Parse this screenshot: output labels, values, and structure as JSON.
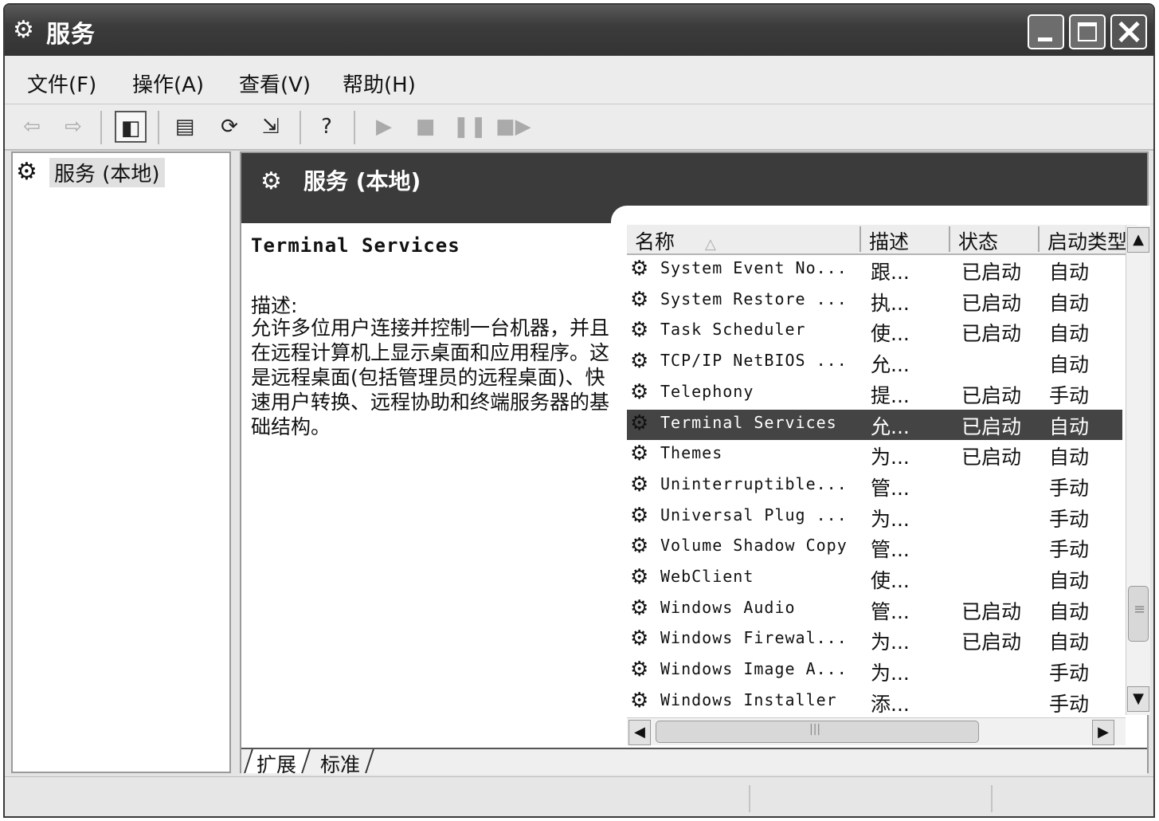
{
  "window": {
    "title": "服务",
    "icon": "services-gear-icon"
  },
  "menu": [
    "文件(F)",
    "操作(A)",
    "查看(V)",
    "帮助(H)"
  ],
  "toolbar": {
    "icons": [
      "back-arrow-icon",
      "forward-arrow-icon",
      "show-hide-tree-icon",
      "properties-icon",
      "refresh-icon",
      "export-list-icon",
      "help-icon",
      "start-service-icon",
      "stop-service-icon",
      "pause-service-icon",
      "restart-service-icon"
    ]
  },
  "tree": {
    "root_label": "服务 (本地)"
  },
  "pane": {
    "header_title": "服务 (本地)",
    "selected_service_name": "Terminal Services",
    "description_label": "描述:",
    "description_text": "允许多位用户连接并控制一台机器，并且在远程计算机上显示桌面和应用程序。这是远程桌面(包括管理员的远程桌面)、快速用户转换、远程协助和终端服务器的基础结构。"
  },
  "list": {
    "columns": [
      "名称",
      "描述",
      "状态",
      "启动类型"
    ],
    "sort_indicator": "△",
    "selected_index": 5,
    "rows": [
      {
        "name": "System Event No...",
        "desc": "跟...",
        "status": "已启动",
        "startup": "自动"
      },
      {
        "name": "System Restore ...",
        "desc": "执...",
        "status": "已启动",
        "startup": "自动"
      },
      {
        "name": "Task Scheduler",
        "desc": "使...",
        "status": "已启动",
        "startup": "自动"
      },
      {
        "name": "TCP/IP NetBIOS ...",
        "desc": "允...",
        "status": "",
        "startup": "自动"
      },
      {
        "name": "Telephony",
        "desc": "提...",
        "status": "已启动",
        "startup": "手动"
      },
      {
        "name": "Terminal Services",
        "desc": "允...",
        "status": "已启动",
        "startup": "自动"
      },
      {
        "name": "Themes",
        "desc": "为...",
        "status": "已启动",
        "startup": "自动"
      },
      {
        "name": "Uninterruptible...",
        "desc": "管...",
        "status": "",
        "startup": "手动"
      },
      {
        "name": "Universal Plug ...",
        "desc": "为...",
        "status": "",
        "startup": "手动"
      },
      {
        "name": "Volume Shadow Copy",
        "desc": "管...",
        "status": "",
        "startup": "手动"
      },
      {
        "name": "WebClient",
        "desc": "使...",
        "status": "",
        "startup": "自动"
      },
      {
        "name": "Windows Audio",
        "desc": "管...",
        "status": "已启动",
        "startup": "自动"
      },
      {
        "name": "Windows Firewal...",
        "desc": "为...",
        "status": "已启动",
        "startup": "自动"
      },
      {
        "name": "Windows Image A...",
        "desc": "为...",
        "status": "",
        "startup": "手动"
      },
      {
        "name": "Windows Installer",
        "desc": "添...",
        "status": "",
        "startup": "手动"
      }
    ]
  },
  "tabs": [
    "扩展",
    "标准"
  ],
  "active_tab_index": 0
}
